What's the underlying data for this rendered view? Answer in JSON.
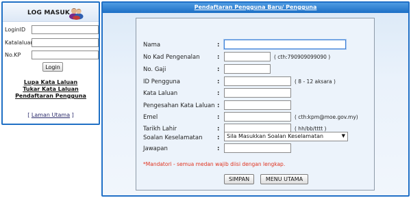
{
  "login": {
    "title": "LOG MASUK",
    "login_id_label": "LoginID",
    "password_label": "Katalaluan",
    "kp_label": "No.KP",
    "login_button": "Login",
    "forgot_password_link": "Lupa Kata Laluan",
    "change_password_link": "Tukar Kata Laluan",
    "register_link": "Pendaftaran Pengguna",
    "main_page_link": "Laman Utama"
  },
  "registration": {
    "title": "Pendaftaran Pengguna Baru/ Pengguna",
    "fields": {
      "nama": "Nama",
      "no_kad": "No Kad Pengenalan",
      "no_gaji": "No. Gaji",
      "id_pengguna": "ID Pengguna",
      "kata_laluan": "Kata Laluan",
      "pengesahan": "Pengesahan Kata Laluan",
      "emel": "Emel",
      "tarikh_lahir": "Tarikh Lahir",
      "soalan": "Soalan Keselamatan",
      "jawapan": "Jawapan"
    },
    "hints": {
      "no_kad": "( cth:790909099090 )",
      "id_pengguna": "( 8 - 12 aksara )",
      "emel": "( cth:kpm@moe.gov.my)",
      "tarikh_lahir": "( hh/bb/tttt )"
    },
    "security_question_selected": "Sila Masukkan Soalan Keselamatan",
    "mandatory_note": "*Mandatori - semua medan wajib diisi dengan lengkap.",
    "save_button": "SIMPAN",
    "menu_button": "MENU UTAMA"
  }
}
